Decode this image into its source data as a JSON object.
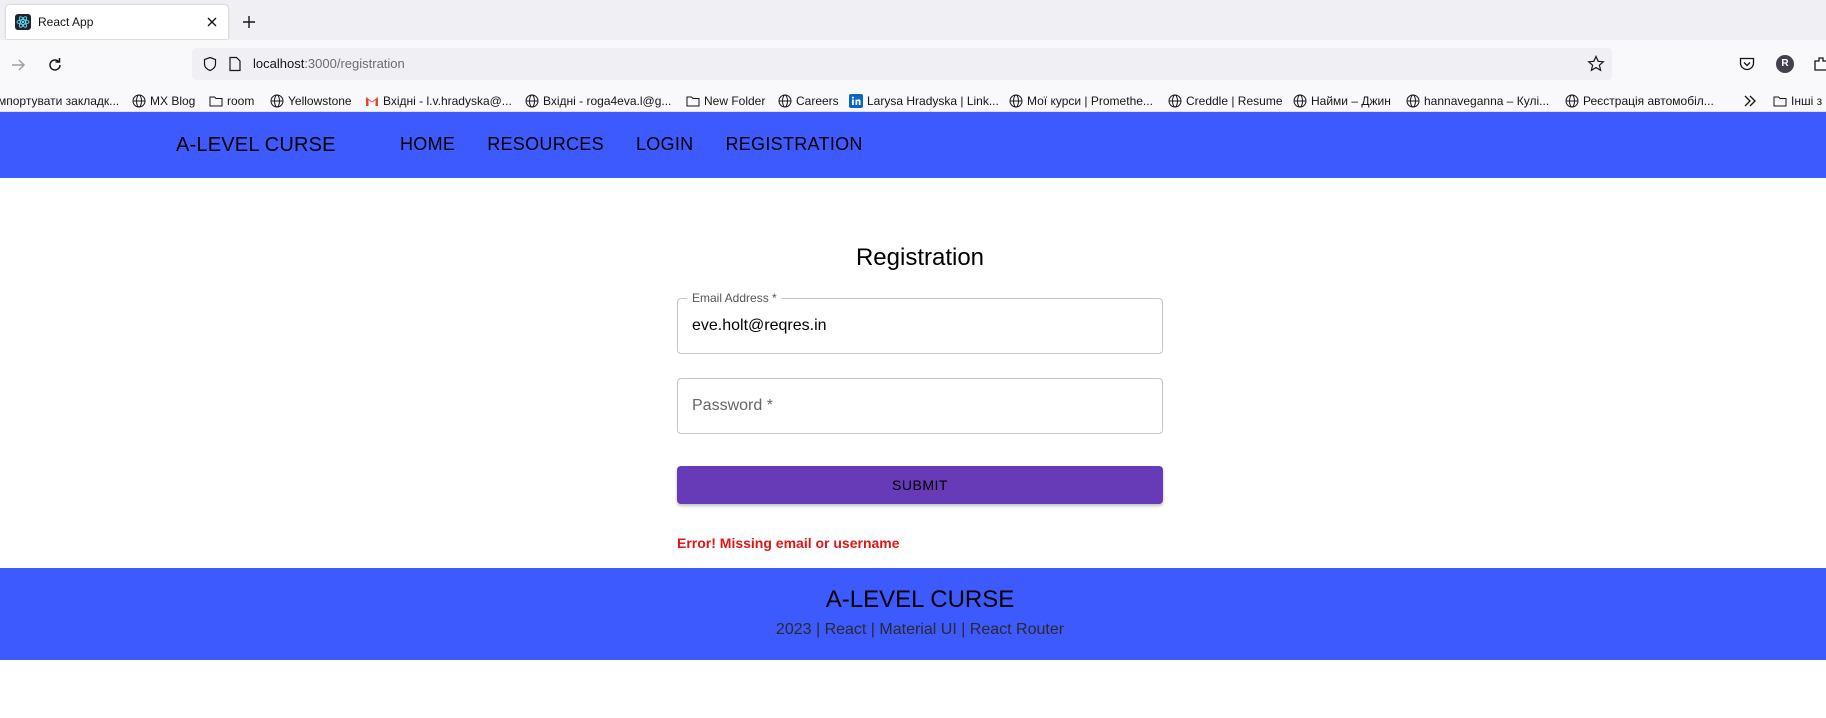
{
  "browser": {
    "tab_title": "React App",
    "url_host": "localhost",
    "url_path": ":3000/registration",
    "account_initial": "R",
    "bookmarks": [
      {
        "label": "мпортувати закладк...",
        "icon": "none"
      },
      {
        "label": "MX Blog",
        "icon": "globe-icon"
      },
      {
        "label": "room",
        "icon": "folder-icon"
      },
      {
        "label": "Yellowstone",
        "icon": "globe-icon"
      },
      {
        "label": "Вхідні - l.v.hradyska@...",
        "icon": "gmail-icon"
      },
      {
        "label": "Вхідні - roga4eva.l@g...",
        "icon": "globe-icon"
      },
      {
        "label": "New Folder",
        "icon": "folder-icon"
      },
      {
        "label": "Careers",
        "icon": "globe-icon"
      },
      {
        "label": "Larysa Hradyska | Link...",
        "icon": "linkedin-icon"
      },
      {
        "label": "Мої курси | Promethe...",
        "icon": "globe-icon"
      },
      {
        "label": "Creddle | Resume",
        "icon": "globe-icon"
      },
      {
        "label": "Найми – Джин",
        "icon": "globe-icon"
      },
      {
        "label": "hannaveganna – Кулі...",
        "icon": "globe-icon"
      },
      {
        "label": "Реєстрація автомобіл...",
        "icon": "globe-icon"
      },
      {
        "label": "Інші з",
        "icon": "folder-icon"
      }
    ]
  },
  "header": {
    "brand": "A-LEVEL CURSE",
    "menu": [
      "HOME",
      "RESOURCES",
      "LOGIN",
      "REGISTRATION"
    ]
  },
  "form": {
    "title": "Registration",
    "email_label": "Email Address *",
    "email_value": "eve.holt@reqres.in",
    "password_placeholder": "Password *",
    "submit_label": "SUBMIT",
    "error": "Error! Missing email or username"
  },
  "footer": {
    "title": "A-LEVEL CURSE",
    "subtitle": "2023 | React | Material UI | React Router"
  },
  "colors": {
    "header_bg": "#3d5afe",
    "button_bg": "#673ab7",
    "error": "#e01515"
  }
}
